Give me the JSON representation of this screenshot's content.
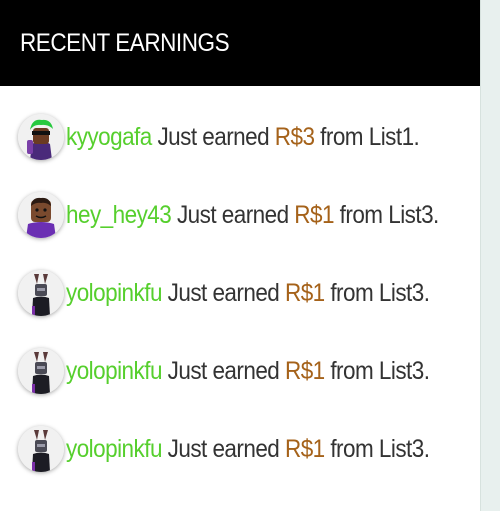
{
  "header": {
    "title": "RECENT EARNINGS"
  },
  "colors": {
    "username": "#56cf2d",
    "amount": "#a5621a",
    "text": "#333333",
    "header_bg": "#000000"
  },
  "earnings": [
    {
      "user": "kyyogafa",
      "mid": " Just earned ",
      "amount": "R$3",
      "tail": " from List1.",
      "avatar": "green-hair-avatar-icon"
    },
    {
      "user": "hey_hey43",
      "mid": " Just earned ",
      "amount": "R$1",
      "tail": " from List3.",
      "avatar": "classic-avatar-icon"
    },
    {
      "user": "yolopinkfu",
      "mid": " Just earned ",
      "amount": "R$1",
      "tail": " from List3.",
      "avatar": "bunny-ears-avatar-icon"
    },
    {
      "user": "yolopinkfu",
      "mid": " Just earned ",
      "amount": "R$1",
      "tail": " from List3.",
      "avatar": "bunny-ears-avatar-icon"
    },
    {
      "user": "yolopinkfu",
      "mid": " Just earned ",
      "amount": "R$1",
      "tail": " from List3.",
      "avatar": "bunny-ears-avatar-icon"
    }
  ]
}
